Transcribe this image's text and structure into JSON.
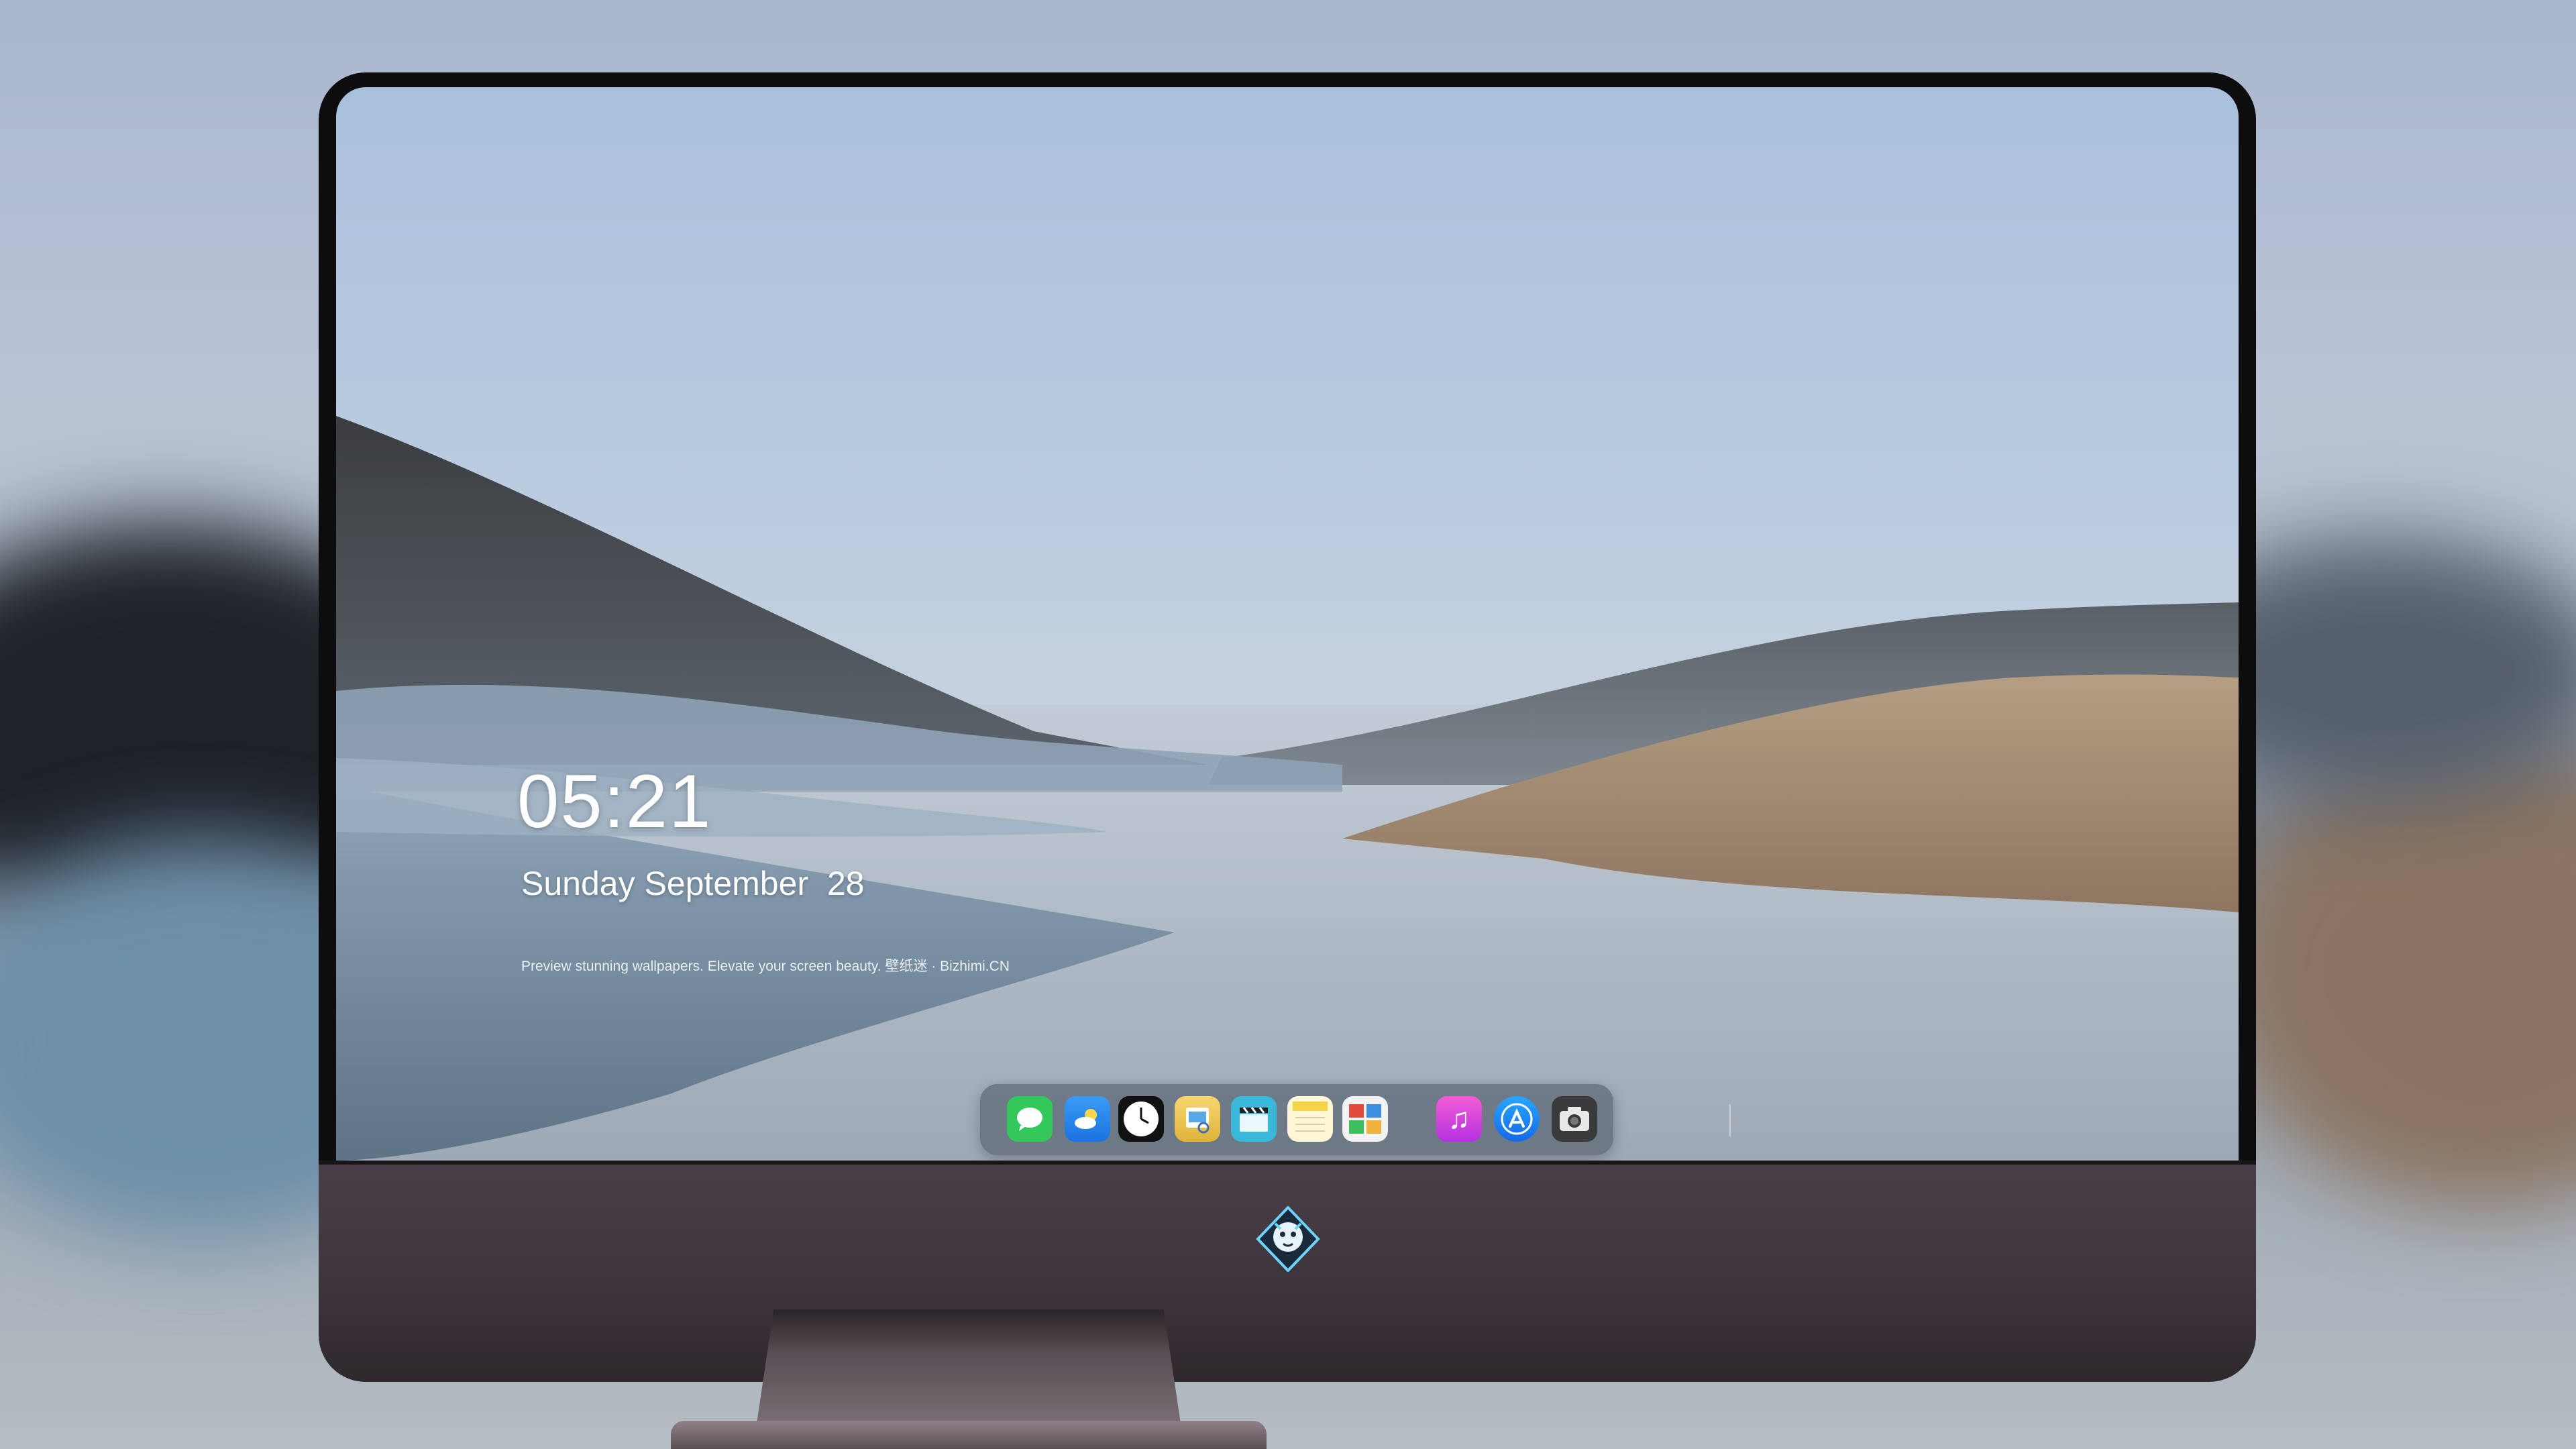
{
  "lock_screen": {
    "time": "05:21",
    "date": "Sunday September  28",
    "tagline": "Preview stunning wallpapers. Elevate your screen beauty. 壁纸迷 · Bizhimi.CN"
  },
  "dock": {
    "apps": [
      {
        "name": "Messages",
        "icon": "messages-icon",
        "color": "#34c759"
      },
      {
        "name": "Weather",
        "icon": "weather-icon",
        "color": "#2f8cf0"
      },
      {
        "name": "Clock",
        "icon": "clock-icon",
        "color": "#111111"
      },
      {
        "name": "Preview",
        "icon": "preview-icon",
        "color": "#e8c24a"
      },
      {
        "name": "Clips",
        "icon": "clapperboard-icon",
        "color": "#3ab8d8"
      },
      {
        "name": "Notes",
        "icon": "notes-icon",
        "color": "#f7d34a"
      },
      {
        "name": "Photo Booth",
        "icon": "photo-booth-icon",
        "color": "#d84b3c"
      },
      {
        "name": "Music",
        "icon": "music-icon",
        "color": "#e03ad6"
      },
      {
        "name": "App Store",
        "icon": "app-store-icon",
        "color": "#1c8ef5"
      },
      {
        "name": "Camera",
        "icon": "camera-icon",
        "color": "#3a3a3c"
      }
    ]
  },
  "colors": {
    "monitor_chin": "#3e353c",
    "bezel": "#0d0d10",
    "sky": "#b9cbe0"
  }
}
